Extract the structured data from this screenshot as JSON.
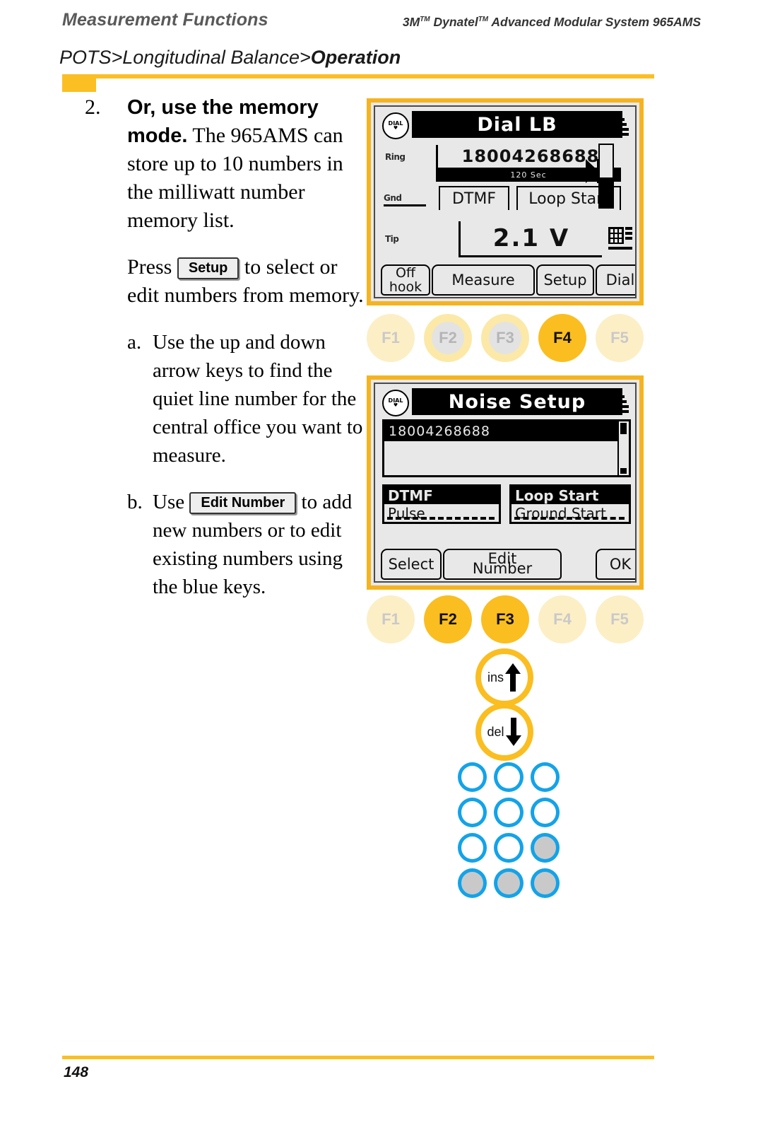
{
  "header": {
    "section_title": "Measurement Functions",
    "product_line_pre": "3M",
    "product_line_mid": "Dynatel",
    "product_line_post": "Advanced Modular System 965AMS",
    "tm": "TM",
    "breadcrumb_prefix": "POTS>Longitudinal Balance>",
    "breadcrumb_current": "Operation"
  },
  "body": {
    "step2": {
      "marker": "2.",
      "lead_bold": "Or, use the memory mode.",
      "rest": " The 965AMS can store up to 10 numbers in the milliwatt number memory list.",
      "press_pre": "Press",
      "press_key": "Setup",
      "press_post": "to select or edit numbers from memory."
    },
    "step_a": {
      "marker": "a.",
      "text": "Use the up and down arrow keys to find the quiet line number for the central office you want to measure."
    },
    "step_b": {
      "marker": "b.",
      "pre": "Use",
      "key": "Edit Number",
      "post": "to add new numbers or to edit existing numbers using the blue keys."
    }
  },
  "lcd1": {
    "badge_line1": "DIAL",
    "badge_line2": "♥",
    "title": "Dial LB",
    "number": "18004268688",
    "status_strip": "120 Sec",
    "label_ring": "Ring",
    "label_gnd": "Gnd",
    "label_tip": "Tip",
    "mode_dtmf": "DTMF",
    "mode_loop": "Loop Start",
    "voltage": "2.1 V",
    "softkeys": [
      "Off hook",
      "Measure",
      "Setup",
      "Dial"
    ],
    "fkeys": [
      {
        "label": "F1",
        "state": "off"
      },
      {
        "label": "F2",
        "state": "ring"
      },
      {
        "label": "F3",
        "state": "ring"
      },
      {
        "label": "F4",
        "state": "on"
      },
      {
        "label": "F5",
        "state": "off"
      }
    ]
  },
  "lcd2": {
    "badge_line1": "DIAL",
    "badge_line2": "♥",
    "title": "Noise Setup",
    "list_selected": "18004268688",
    "dial_mode_options": [
      {
        "label": "DTMF",
        "selected": true
      },
      {
        "label": "Pulse",
        "selected": false
      }
    ],
    "start_mode_options": [
      {
        "label": "Loop Start",
        "selected": true
      },
      {
        "label": "Ground Start",
        "selected": false
      }
    ],
    "softkeys": [
      "Select",
      "Edit",
      "Number",
      "OK"
    ],
    "fkeys": [
      {
        "label": "F1",
        "state": "off"
      },
      {
        "label": "F2",
        "state": "on"
      },
      {
        "label": "F3",
        "state": "on"
      },
      {
        "label": "F4",
        "state": "off"
      },
      {
        "label": "F5",
        "state": "off"
      }
    ]
  },
  "arrow_keys": {
    "ins_label": "ins",
    "del_label": "del"
  },
  "keypad": {
    "rows": [
      [
        "open",
        "open",
        "open"
      ],
      [
        "open",
        "open",
        "open"
      ],
      [
        "open",
        "open",
        "grey"
      ],
      [
        "grey",
        "grey",
        "grey"
      ]
    ]
  },
  "footer": {
    "page_number": "148"
  },
  "colors": {
    "accent_yellow": "#FBBF24",
    "key_amber": "#FBBE20",
    "key_pale": "#FCEFC6",
    "keypad_blue": "#13A3E8",
    "lcd_bg": "#e8e8e8"
  }
}
